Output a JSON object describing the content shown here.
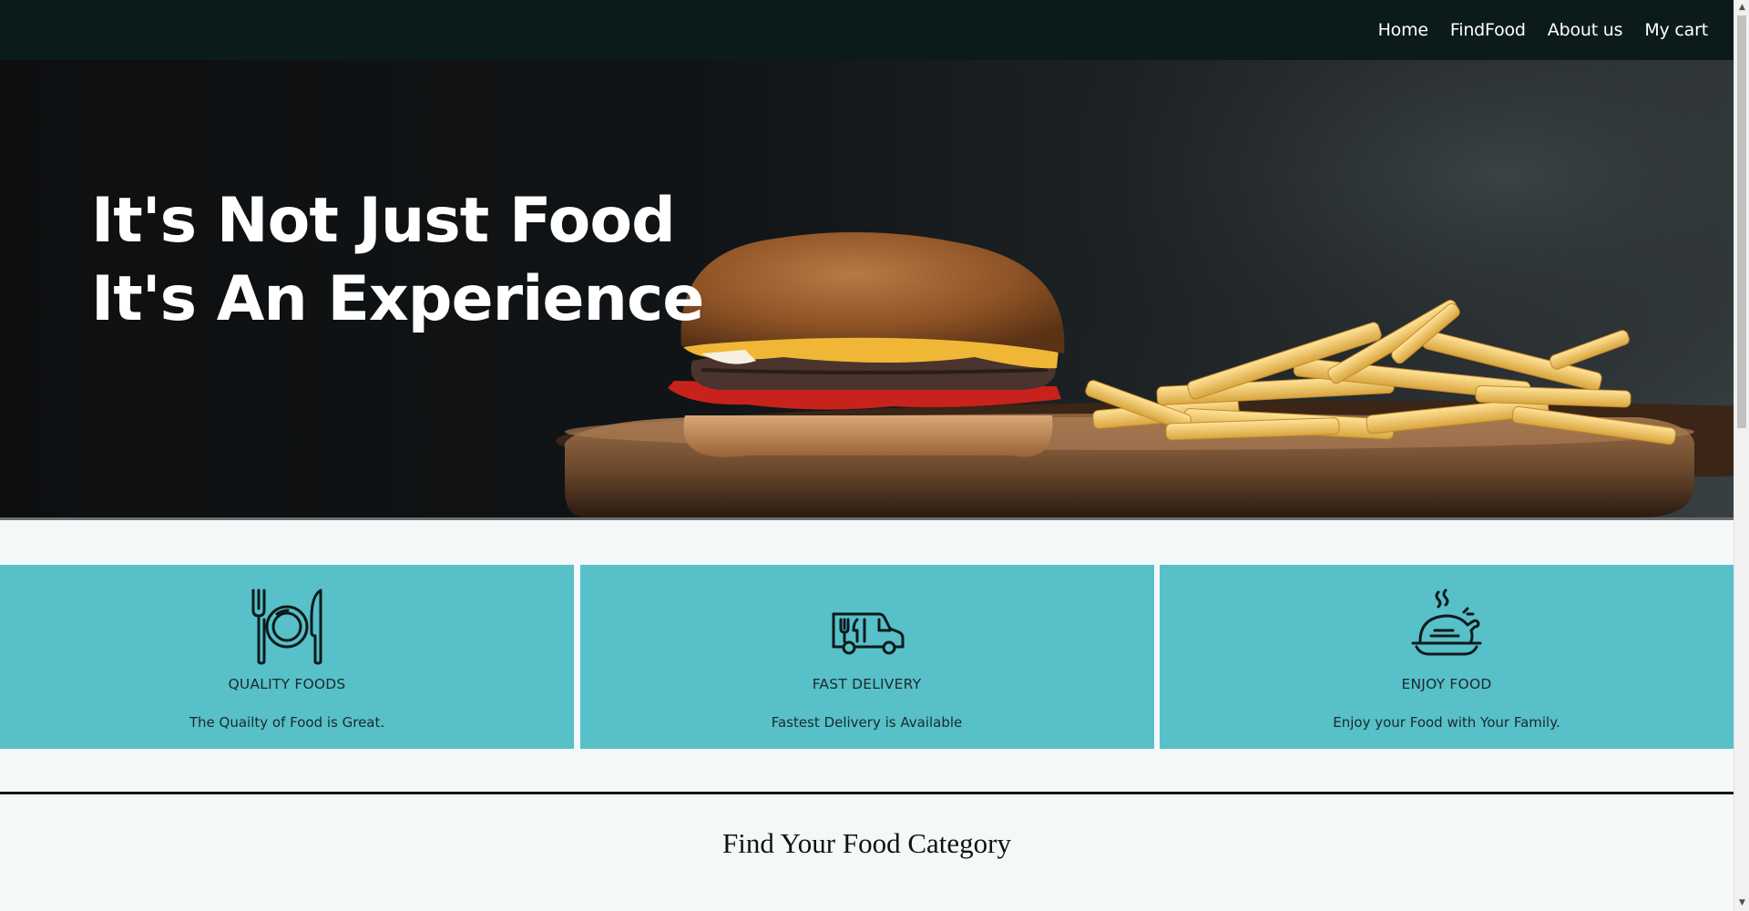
{
  "nav": {
    "items": [
      {
        "label": "Home"
      },
      {
        "label": "FindFood"
      },
      {
        "label": "About us"
      },
      {
        "label": "My cart"
      }
    ]
  },
  "hero": {
    "line1": "It's Not Just Food",
    "line2": "It's An Experience"
  },
  "features": [
    {
      "icon": "plate-cutlery-icon",
      "title": "QUALITY FOODS",
      "description": "The Quailty of Food is Great."
    },
    {
      "icon": "delivery-van-icon",
      "title": "FAST DELIVERY",
      "description": "Fastest Delivery is Available"
    },
    {
      "icon": "roast-chicken-icon",
      "title": "ENJOY FOOD",
      "description": "Enjoy your Food with Your Family."
    }
  ],
  "section": {
    "title": "Find Your Food Category"
  },
  "colors": {
    "navbar": "#0b1a1b",
    "card": "#57c0c8",
    "background": "#f5f8f9"
  }
}
